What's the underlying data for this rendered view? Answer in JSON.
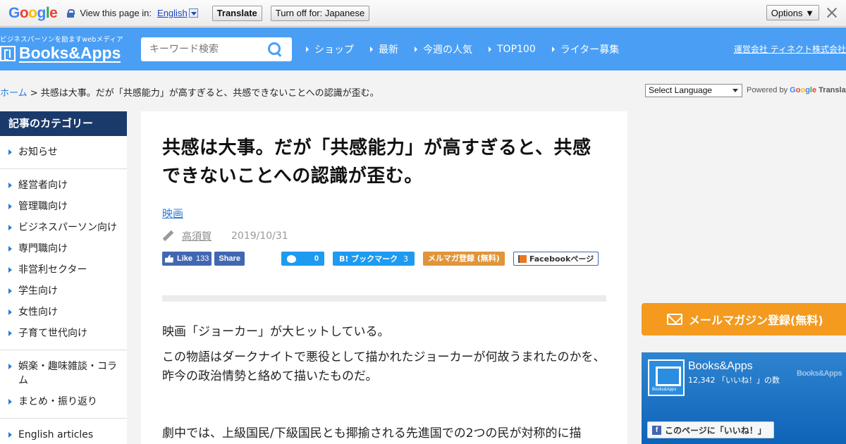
{
  "translate_bar": {
    "logo": "Google",
    "label": "View this page in:",
    "language": "English",
    "translate_button": "Translate",
    "turn_off_button": "Turn off for: Japanese",
    "options_button": "Options ▼"
  },
  "header": {
    "tagline": "ビジネスパーソンを励ますwebメディア",
    "brand": "Books&Apps",
    "search_placeholder": "キーワード検索",
    "nav": [
      "ショップ",
      "最新",
      "今週の人気",
      "TOP100",
      "ライター募集"
    ],
    "company": "運営会社 ティネクト株式会社"
  },
  "breadcrumb": {
    "home": "ホーム",
    "separator": " > ",
    "current": "共感は大事。だが「共感能力」が高すぎると、共感できないことへの認識が歪む。"
  },
  "language_widget": {
    "select_label": "Select Language",
    "powered_by": "Powered by",
    "google": "Google",
    "translate": "Translate"
  },
  "sidebar": {
    "heading": "記事のカテゴリー",
    "groups": [
      [
        "お知らせ"
      ],
      [
        "経営者向け",
        "管理職向け",
        "ビジネスパーソン向け",
        "専門職向け",
        "非営利セクター",
        "学生向け",
        "女性向け",
        "子育て世代向け"
      ],
      [
        "娯楽・趣味雑談・コラム",
        "まとめ・振り返り"
      ],
      [
        "English articles"
      ]
    ]
  },
  "article": {
    "title": "共感は大事。だが「共感能力」が高すぎると、共感できないことへの認識が歪む。",
    "category": "映画",
    "author": "高須賀",
    "date": "2019/10/31",
    "share": {
      "fb_like": "Like",
      "fb_like_count": "133",
      "fb_share": "Share",
      "twitter_count": "0",
      "hatena": "B! ブックマーク",
      "hatena_count": "3",
      "mailmag": "メルマガ登録 (無料)",
      "facebook_page": "Facebookページ"
    },
    "paragraphs": [
      "映画「ジョーカー」が大ヒットしている。",
      "この物語はダークナイトで悪役として描かれたジョーカーが何故うまれたのかを、昨今の政治情勢と絡めて描いたものだ。",
      "劇中では、上級国民/下級国民とも揶揄される先進国での2つの民が対称的に描"
    ]
  },
  "right": {
    "mail_button": "メールマガジン登録(無料)",
    "fb_widget_name": "Books&Apps",
    "fb_widget_count": "12,342 「いいね！」の数",
    "fb_widget_brand": "Books&Apps",
    "fb_widget_like": "このページに「いいね！」"
  },
  "colors": {
    "header_blue": "#4a9ff5",
    "sidebar_head": "#1a3a6b",
    "link": "#2a7cd6",
    "mail_orange": "#f39a1f"
  }
}
